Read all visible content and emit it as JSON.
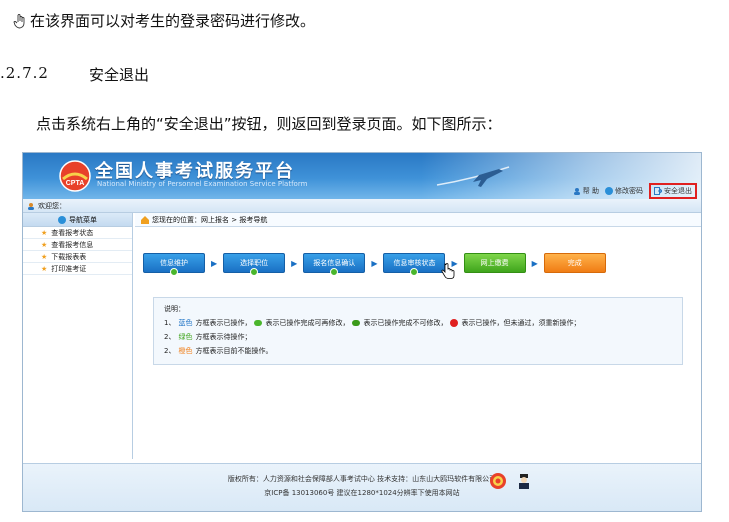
{
  "doc": {
    "line1": "在该界面可以对考生的登录密码进行修改。",
    "section_number": ".2.7.2",
    "section_title": "安全退出",
    "description": "点击系统右上角的“安全退出”按钮，则返回到登录页面。如下图所示："
  },
  "screenshot": {
    "title": "全国人事考试服务平台",
    "subtitle": "National Ministry of Personnel Examination Service Platform",
    "logo_text": "CPTA",
    "links": {
      "help": "帮 助",
      "change_password": "修改密码",
      "logout": "安全退出"
    },
    "welcome": "欢迎您：",
    "sidebar": {
      "header": "导航菜单",
      "items": [
        {
          "label": "查看报考状态"
        },
        {
          "label": "查看报考信息"
        },
        {
          "label": "下载报表表"
        },
        {
          "label": "打印准考证"
        }
      ]
    },
    "breadcrumb": "您现在的位置：网上报名 > 报考导航",
    "steps": [
      {
        "label": "信息维护",
        "color": "blue"
      },
      {
        "label": "选择职位",
        "color": "blue"
      },
      {
        "label": "报名信息确认",
        "color": "blue"
      },
      {
        "label": "信息审核状态",
        "color": "blue"
      },
      {
        "label": "网上缴费",
        "color": "green"
      },
      {
        "label": "完成",
        "color": "orange"
      }
    ],
    "notes": {
      "heading": "说明：",
      "line1_prefix": "1、",
      "line1_blue": "蓝色",
      "line1_a": "方框表示已操作，",
      "line1_b": "表示已操作完成可再修改，",
      "line1_c": "表示已操作完成不可修改，",
      "line1_d": "表示已操作，但未通过，须重新操作；",
      "line2_prefix": "2、",
      "line2_green": "绿色",
      "line2_text": "方框表示待操作；",
      "line3_prefix": "2、",
      "line3_orange": "橙色",
      "line3_text": "方框表示目前不能操作。"
    },
    "footer": {
      "line1": "版权所有：人力资源和社会保障部人事考试中心 技术支持：山东山大鸥玛软件有限公司",
      "line2": "京ICP备 13013060号 建议在1280*1024分辨率下使用本网站"
    }
  },
  "colors": {
    "accent_blue": "#1a70c4",
    "step_green": "#3fa51c",
    "step_orange": "#f07c14",
    "logout_highlight": "#e02020"
  }
}
